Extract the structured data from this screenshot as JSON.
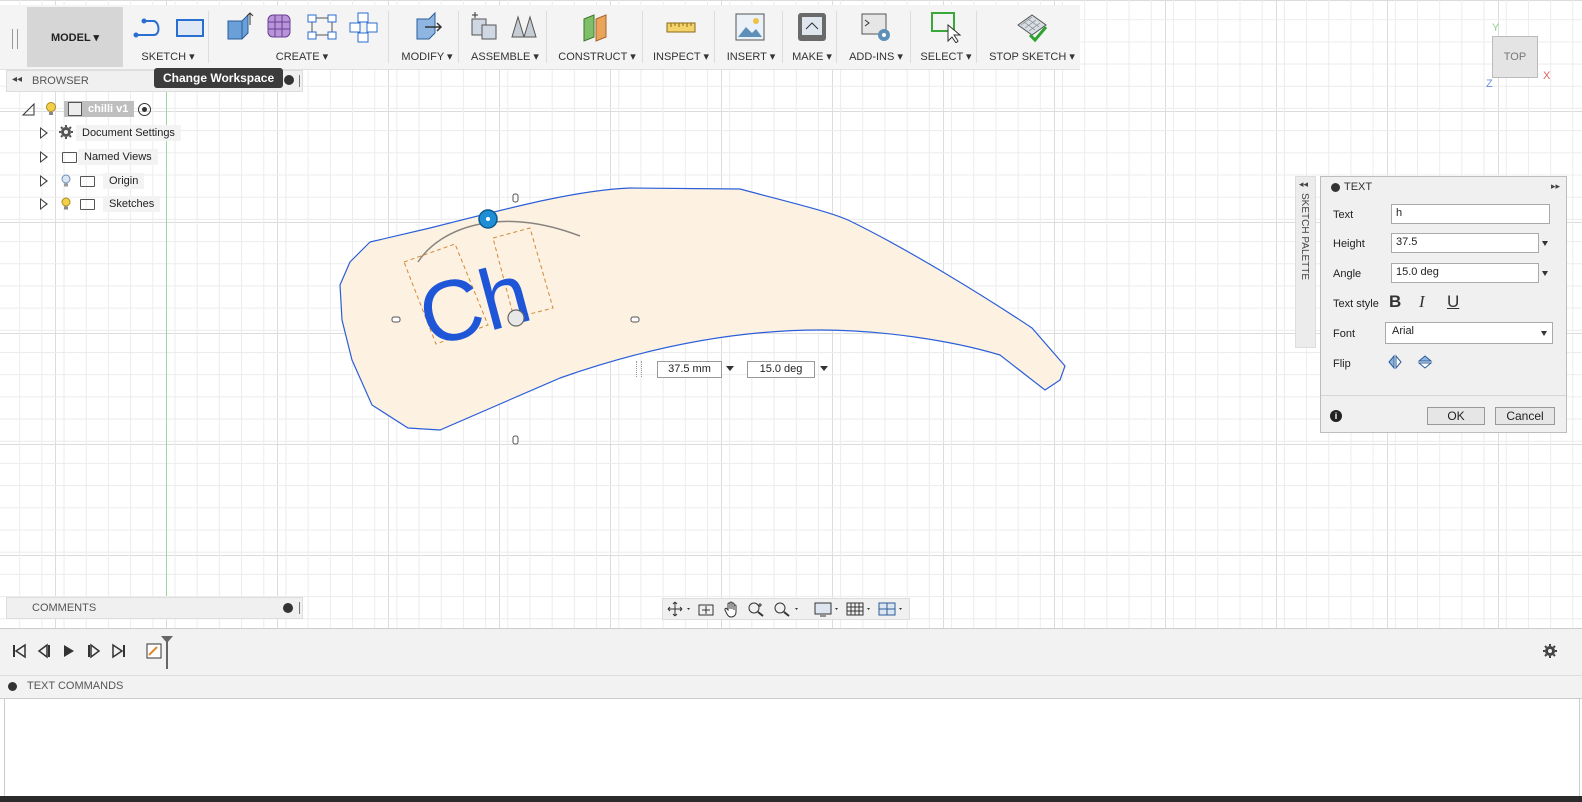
{
  "toolbar": {
    "workspace_label": "MODEL ▾",
    "groups": [
      {
        "id": "sketch",
        "label": "SKETCH ▾"
      },
      {
        "id": "create",
        "label": "CREATE ▾"
      },
      {
        "id": "modify",
        "label": "MODIFY ▾"
      },
      {
        "id": "assemble",
        "label": "ASSEMBLE ▾"
      },
      {
        "id": "construct",
        "label": "CONSTRUCT ▾"
      },
      {
        "id": "inspect",
        "label": "INSPECT ▾"
      },
      {
        "id": "insert",
        "label": "INSERT ▾"
      },
      {
        "id": "make",
        "label": "MAKE ▾"
      },
      {
        "id": "addins",
        "label": "ADD-INS ▾"
      },
      {
        "id": "select",
        "label": "SELECT ▾"
      },
      {
        "id": "stopsketch",
        "label": "STOP SKETCH ▾"
      }
    ]
  },
  "tooltip": "Change Workspace",
  "browser": {
    "title": "BROWSER",
    "root": "chilli v1",
    "items": [
      {
        "label": "Document Settings",
        "icon": "gear-icon"
      },
      {
        "label": "Named Views",
        "icon": "folder-icon"
      },
      {
        "label": "Origin",
        "icon": "folder-icon"
      },
      {
        "label": "Sketches",
        "icon": "folder-icon"
      }
    ]
  },
  "comments": {
    "title": "COMMENTS"
  },
  "canvas": {
    "sketch_text": "Ch",
    "height_input": "37.5 mm",
    "angle_input": "15.0 deg"
  },
  "viewcube": {
    "face": "TOP",
    "axis_x": "X",
    "axis_y": "Y",
    "axis_z": "Z"
  },
  "palette": {
    "label": "SKETCH PALETTE"
  },
  "text_dialog": {
    "title": "TEXT",
    "text_label": "Text",
    "text_value": "h",
    "height_label": "Height",
    "height_value": "37.5",
    "angle_label": "Angle",
    "angle_value": "15.0 deg",
    "style_label": "Text style",
    "font_label": "Font",
    "font_value": "Arial",
    "flip_label": "Flip",
    "ok": "OK",
    "cancel": "Cancel"
  },
  "text_commands": {
    "title": "TEXT COMMANDS"
  },
  "colors": {
    "accent": "#1e8fd6",
    "sketch_profile": "#2b5fd9",
    "profile_fill": "#fdf1e2",
    "sketch_text": "#1f56d8"
  }
}
